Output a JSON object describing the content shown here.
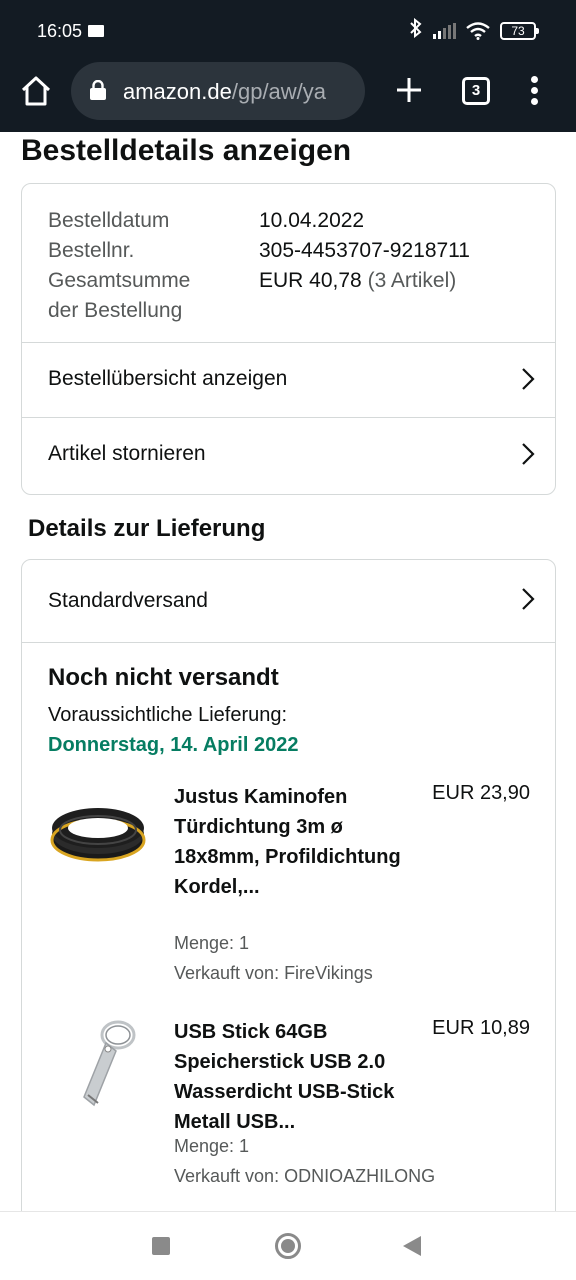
{
  "status_bar": {
    "time": "16:05",
    "battery": "73"
  },
  "browser": {
    "url_host": "amazon.de",
    "url_path": "/gp/aw/ya",
    "tab_count": "3"
  },
  "page": {
    "title": "Bestelldetails anzeigen"
  },
  "order": {
    "date_label": "Bestelldatum",
    "date_value": "10.04.2022",
    "number_label": "Bestellnr.",
    "number_value": "305-4453707-9218711",
    "total_label_line1": "Gesamtsumme",
    "total_label_line2": "der Bestellung",
    "total_value": "EUR 40,78",
    "total_items": "(3 Artikel)",
    "overview_link": "Bestellübersicht anzeigen",
    "cancel_link": "Artikel stornieren"
  },
  "delivery": {
    "section_title": "Details zur Lieferung",
    "shipping_method": "Standardversand",
    "status": "Noch nicht versandt",
    "eta_label": "Voraussichtliche Lieferung:",
    "eta_date": "Donnerstag, 14. April 2022"
  },
  "items": [
    {
      "title": "Justus Kaminofen Türdichtung 3m ø 18x8mm, Profildichtung Kordel,...",
      "price": "EUR 23,90",
      "quantity": "Menge: 1",
      "seller": "Verkauft von: FireVikings"
    },
    {
      "title": "USB Stick 64GB Speicherstick USB 2.0 Wasserdicht USB-Stick Metall USB...",
      "price": "EUR 10,89",
      "quantity": "Menge: 1",
      "seller": "Verkauft von: ODNIOAZHILONG"
    }
  ],
  "colors": {
    "status_bar_bg": "#131b23",
    "delivery_green": "#067d62",
    "border": "#d5d9d9"
  },
  "icons": {
    "home": "home-icon",
    "lock": "lock-icon",
    "new_tab": "plus-icon",
    "menu": "more-vertical-icon",
    "chevron": "chevron-right-icon"
  }
}
